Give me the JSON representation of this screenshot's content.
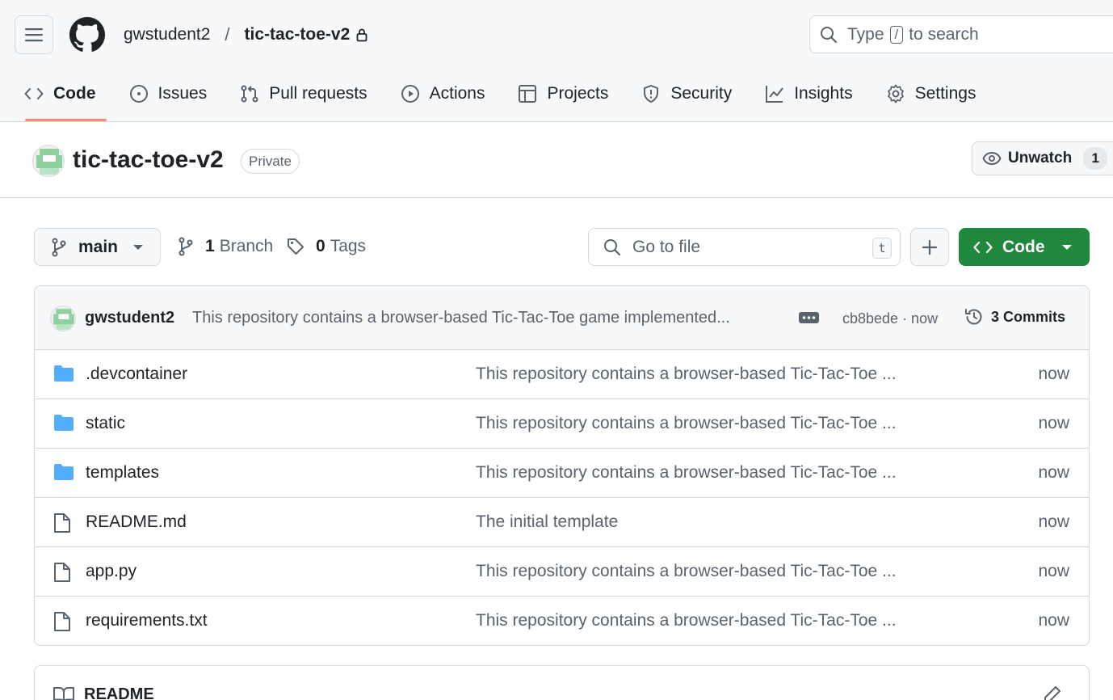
{
  "header": {
    "owner": "gwstudent2",
    "separator": "/",
    "repo": "tic-tac-toe-v2",
    "search": {
      "prefix": "Type",
      "key": "/",
      "suffix": "to search"
    }
  },
  "tabs": [
    {
      "label": "Code",
      "icon": "code-icon",
      "active": true
    },
    {
      "label": "Issues",
      "icon": "issue-opened-icon"
    },
    {
      "label": "Pull requests",
      "icon": "git-pull-request-icon"
    },
    {
      "label": "Actions",
      "icon": "play-icon"
    },
    {
      "label": "Projects",
      "icon": "table-icon"
    },
    {
      "label": "Security",
      "icon": "shield-icon"
    },
    {
      "label": "Insights",
      "icon": "graph-icon"
    },
    {
      "label": "Settings",
      "icon": "gear-icon"
    }
  ],
  "repo_head": {
    "name": "tic-tac-toe-v2",
    "visibility": "Private",
    "watch_label": "Unwatch",
    "watch_count": "1"
  },
  "controls": {
    "branch": "main",
    "branch_count": "1",
    "branch_label": "Branch",
    "tag_count": "0",
    "tag_label": "Tags",
    "goto_placeholder": "Go to file",
    "goto_shortcut": "t",
    "code_label": "Code"
  },
  "latest_commit": {
    "author": "gwstudent2",
    "message": "This repository contains a browser-based Tic-Tac-Toe game implemented...",
    "hash_time": "cb8bede · now",
    "commits_label": "3 Commits"
  },
  "files": [
    {
      "type": "folder",
      "name": ".devcontainer",
      "message": "This repository contains a browser-based Tic-Tac-Toe ...",
      "time": "now"
    },
    {
      "type": "folder",
      "name": "static",
      "message": "This repository contains a browser-based Tic-Tac-Toe ...",
      "time": "now"
    },
    {
      "type": "folder",
      "name": "templates",
      "message": "This repository contains a browser-based Tic-Tac-Toe ...",
      "time": "now"
    },
    {
      "type": "file",
      "name": "README.md",
      "message": "The initial template",
      "time": "now"
    },
    {
      "type": "file",
      "name": "app.py",
      "message": "This repository contains a browser-based Tic-Tac-Toe ...",
      "time": "now"
    },
    {
      "type": "file",
      "name": "requirements.txt",
      "message": "This repository contains a browser-based Tic-Tac-Toe ...",
      "time": "now"
    }
  ],
  "readme": {
    "title": "README"
  },
  "colors": {
    "accent_underline": "#fd8c73",
    "primary_button": "#1f883d",
    "folder": "#54aeff",
    "text_muted": "#59636e",
    "border": "#d1d9e0"
  }
}
